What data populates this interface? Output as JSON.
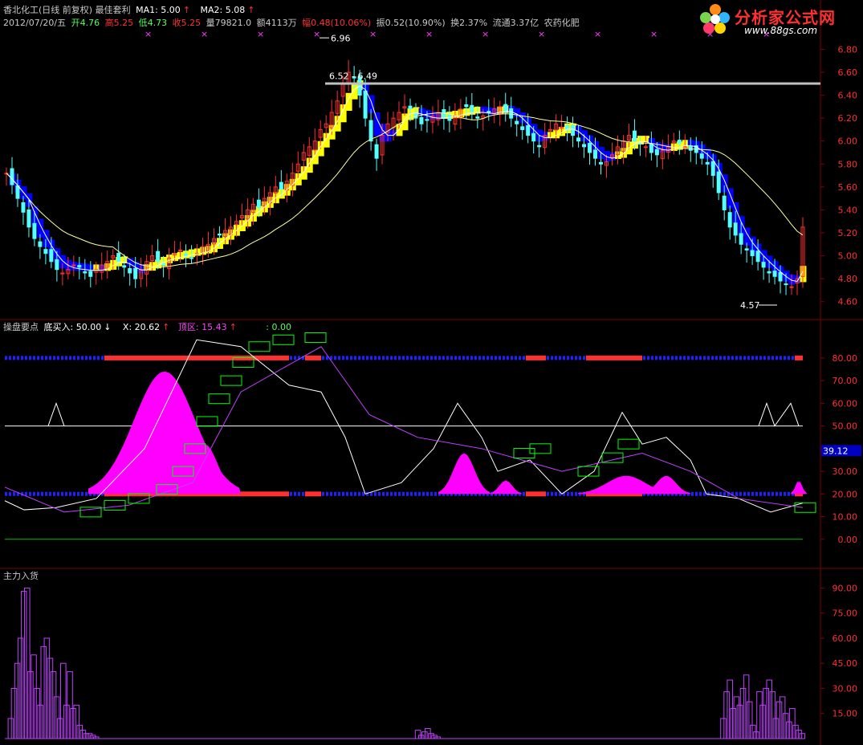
{
  "header": {
    "title": "香北化工(日线 前复权) 最佳套利",
    "ma1": "MA1: 5.00",
    "ma2": "MA2: 5.08",
    "date": "2012/07/20/五",
    "open": "开4.76",
    "high": "高5.25",
    "low": "低4.73",
    "close": "收5.25",
    "volume": "量79821.0",
    "amount": "额4113万",
    "change": "幅0.48(10.06%)",
    "amplitude": "振0.52(10.90%)",
    "turnover": "换2.37%",
    "float": "流通3.37亿",
    "sector": "农药化肥"
  },
  "logo": {
    "name": "分析家公式网",
    "url": "www.88gs.com"
  },
  "colors": {
    "up": "#ff3030",
    "down": "#54ffff",
    "bull_band": "#ffff00",
    "bear_band": "#0000ff",
    "magenta": "#ff00ff",
    "green": "#00ff00",
    "grid": "#800000",
    "axis_text": "#ff3030"
  },
  "chart_data": [
    {
      "type": "candlestick",
      "panel": "price",
      "ylim": [
        4.5,
        6.95
      ],
      "yticks": [
        "6.80",
        "6.60",
        "6.40",
        "6.20",
        "6.00",
        "5.80",
        "5.60",
        "5.40",
        "5.20",
        "5.00",
        "4.80",
        "4.60"
      ],
      "annotations": {
        "high_label": "6.96",
        "range_label": "6.52 - 6.49",
        "low_label": "4.57"
      },
      "close": [
        5.72,
        5.62,
        5.5,
        5.38,
        5.25,
        5.15,
        5.08,
        5.02,
        4.95,
        4.88,
        4.85,
        4.88,
        4.92,
        4.9,
        4.85,
        4.82,
        4.88,
        4.92,
        4.95,
        5.0,
        4.95,
        4.9,
        4.85,
        4.8,
        4.88,
        4.95,
        5.0,
        4.95,
        4.92,
        4.98,
        5.02,
        5.05,
        5.0,
        4.98,
        5.02,
        5.08,
        5.1,
        5.15,
        5.18,
        5.22,
        5.25,
        5.3,
        5.35,
        5.4,
        5.45,
        5.42,
        5.5,
        5.55,
        5.6,
        5.58,
        5.65,
        5.72,
        5.8,
        5.9,
        5.95,
        6.0,
        6.1,
        6.15,
        6.25,
        6.35,
        6.5,
        6.6,
        6.55,
        6.4,
        6.2,
        6.0,
        5.85,
        6.05,
        6.15,
        6.2,
        6.25,
        6.3,
        6.28,
        6.2,
        6.15,
        6.18,
        6.22,
        6.25,
        6.2,
        6.18,
        6.22,
        6.28,
        6.3,
        6.25,
        6.2,
        6.22,
        6.25,
        6.28,
        6.3,
        6.25,
        6.2,
        6.15,
        6.1,
        6.05,
        6.0,
        5.95,
        6.05,
        6.1,
        6.15,
        6.12,
        6.1,
        6.05,
        6.0,
        5.95,
        5.9,
        5.85,
        5.8,
        5.82,
        5.88,
        5.95,
        6.0,
        6.05,
        6.0,
        5.98,
        5.95,
        5.9,
        5.88,
        5.92,
        5.95,
        6.0,
        5.98,
        5.95,
        5.92,
        5.9,
        5.85,
        5.8,
        5.7,
        5.55,
        5.4,
        5.25,
        5.18,
        5.1,
        5.05,
        5.0,
        4.95,
        4.9,
        4.85,
        4.82,
        4.78,
        4.75,
        4.73,
        4.8,
        5.25
      ],
      "series": [
        {
          "name": "MA1",
          "value_last": 5.0
        },
        {
          "name": "MA2",
          "value_last": 5.08
        }
      ]
    },
    {
      "type": "indicator",
      "panel": "middle",
      "title": "操盘要点",
      "legend": [
        "底买入: 50.00",
        "X: 20.62",
        "顶区: 15.43",
        ": 0.00"
      ],
      "value_tag": "39.12",
      "ylim": [
        -10,
        92
      ],
      "yticks": [
        "80.00",
        "70.00",
        "60.00",
        "50.00",
        "40.00",
        "30.00",
        "20.00",
        "10.00",
        "0.00"
      ]
    },
    {
      "type": "bar",
      "panel": "bottom",
      "title": "主力入货",
      "ylim": [
        0,
        95
      ],
      "yticks": [
        "90.00",
        "75.00",
        "60.00",
        "45.00",
        "30.00",
        "15.00"
      ],
      "values": [
        0,
        12,
        30,
        45,
        60,
        88,
        90,
        40,
        50,
        30,
        20,
        55,
        60,
        48,
        40,
        25,
        12,
        45,
        20,
        40,
        18,
        20,
        8,
        5,
        3,
        3,
        2,
        1,
        0,
        0,
        0,
        0,
        0,
        0,
        0,
        0,
        0,
        0,
        0,
        0,
        0,
        0,
        0,
        0,
        0,
        0,
        0,
        0,
        0,
        0,
        0,
        0,
        0,
        0,
        0,
        0,
        0,
        0,
        0,
        0,
        0,
        0,
        0,
        0,
        0,
        0,
        0,
        0,
        0,
        0,
        0,
        0,
        0,
        0,
        0,
        0,
        0,
        0,
        0,
        0,
        0,
        0,
        0,
        0,
        0,
        0,
        0,
        0,
        0,
        0,
        0,
        0,
        0,
        0,
        0,
        0,
        0,
        0,
        0,
        0,
        0,
        0,
        0,
        0,
        0,
        0,
        0,
        0,
        0,
        0,
        0,
        0,
        0,
        0,
        0,
        0,
        0,
        0,
        0,
        0,
        0,
        0,
        0,
        0,
        0,
        5,
        2,
        4,
        6,
        3,
        2,
        1,
        0,
        0,
        0,
        0,
        0,
        0,
        0,
        0,
        0,
        0,
        0,
        0,
        0,
        0,
        0,
        0,
        0,
        0,
        0,
        0,
        0,
        0,
        0,
        0,
        0,
        0,
        0,
        0,
        0,
        0,
        0,
        0,
        0,
        0,
        0,
        0,
        0,
        0,
        0,
        0,
        0,
        0,
        0,
        0,
        0,
        0,
        0,
        0,
        0,
        0,
        0,
        0,
        0,
        0,
        0,
        0,
        0,
        0,
        0,
        0,
        0,
        0,
        0,
        0,
        0,
        0,
        0,
        0,
        0,
        0,
        0,
        0,
        0,
        0,
        0,
        0,
        0,
        0,
        0,
        0,
        0,
        0,
        0,
        0,
        0,
        0,
        12,
        28,
        35,
        18,
        25,
        20,
        30,
        38,
        22,
        8,
        4,
        28,
        20,
        30,
        35,
        28,
        12,
        22,
        25,
        15,
        10,
        18,
        8,
        5,
        3
      ]
    }
  ]
}
